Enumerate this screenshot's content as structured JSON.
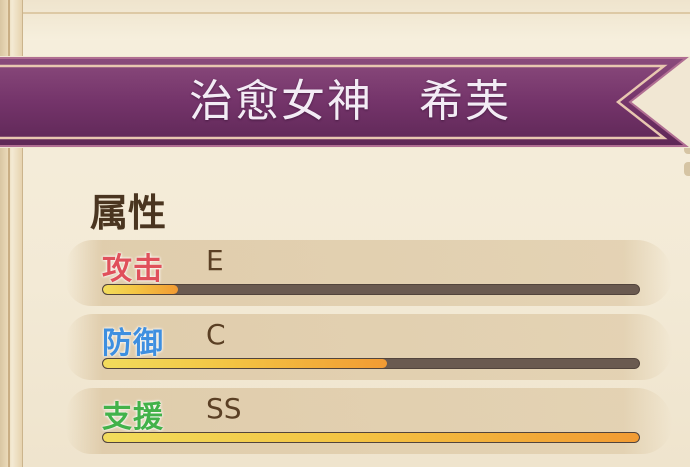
{
  "character": {
    "title": "治愈女神　希芙"
  },
  "attributes": {
    "heading": "属性",
    "stats": [
      {
        "label": "攻击",
        "grade": "E",
        "level": 0.14,
        "color": "#e0505b"
      },
      {
        "label": "防御",
        "grade": "C",
        "level": 0.53,
        "color": "#3e8fe0"
      },
      {
        "label": "支援",
        "grade": "SS",
        "level": 1.0,
        "color": "#42b24a"
      }
    ]
  },
  "colors": {
    "banner": "#7a3a6c",
    "banner_trim": "#e8c7b0",
    "bar_track": "#6a5a50",
    "bar_fill_start": "#f2dc5c",
    "bar_fill_end": "#f29b33"
  }
}
